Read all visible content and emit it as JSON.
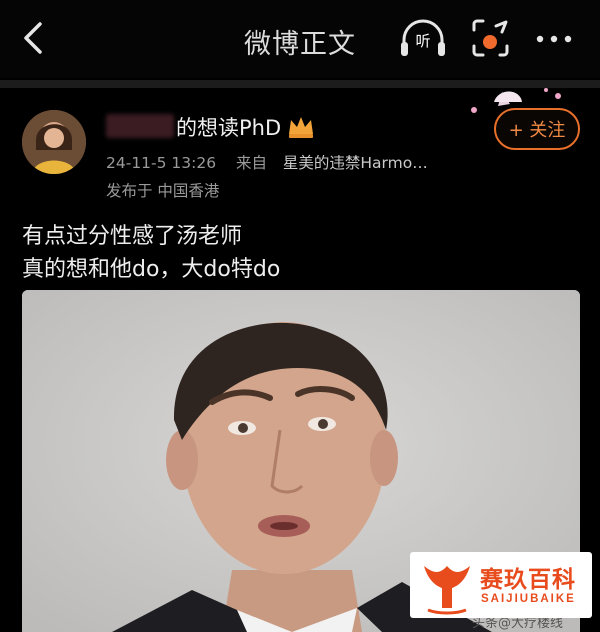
{
  "header": {
    "title": "微博正文",
    "listen_label": "听",
    "icons": {
      "back": "chevron-left-icon",
      "listen": "headphones-icon",
      "share": "share-scan-icon",
      "more": "more-dots-icon"
    }
  },
  "post": {
    "username": "的想读PhD",
    "timestamp": "24-11-5 13:26",
    "source_prefix": "来自",
    "source": "星美的违禁Harmo…",
    "location": "发布于 中国香港",
    "follow_label": "+ 关注",
    "text_lines": [
      "有点过分性感了汤老师",
      "真的想和他do，大do特do"
    ]
  },
  "watermark": {
    "logo_text": "赛玖百科",
    "logo_sub": "SAIJIUBAIKE",
    "caption": "头条@大疗楼线"
  },
  "colors": {
    "accent": "#e8702a",
    "background": "#000000",
    "logo": "#e84c1c"
  }
}
